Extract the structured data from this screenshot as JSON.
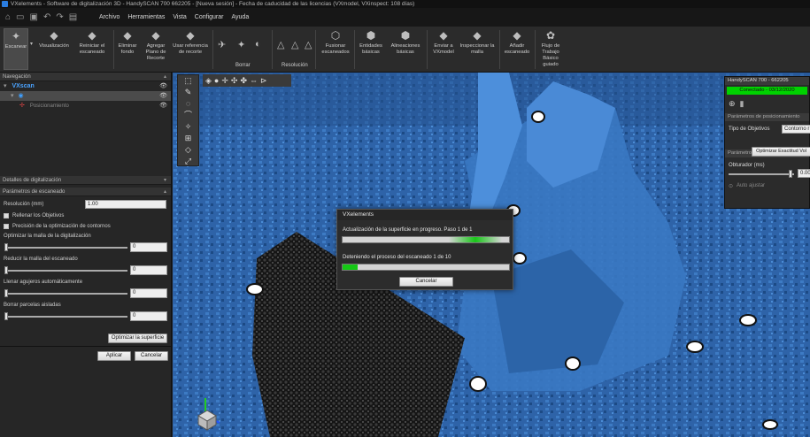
{
  "window": {
    "title": "VXelements - Software de digitalización 3D - HandySCAN 700 662205 - [Nueva sesión] - Fecha de caducidad de las licencias (VXmodel, VXinspect: 108 días)"
  },
  "menubar": {
    "items": [
      "Archivo",
      "Herramientas",
      "Vista",
      "Configurar",
      "Ayuda"
    ]
  },
  "ribbon": {
    "buttons": [
      {
        "label": "Escanear",
        "icon": "scan-icon"
      },
      {
        "label": "Visualización",
        "icon": "visualization-icon"
      },
      {
        "label": "Reiniciar el escaneado",
        "icon": "reset-scan-icon"
      },
      {
        "label": "Eliminar fondo",
        "icon": "remove-background-icon"
      },
      {
        "label": "Agregar Plano de Recorte",
        "icon": "clipping-plane-icon"
      },
      {
        "label": "Usar referencia de recorte",
        "icon": "clip-reference-icon"
      },
      {
        "label": "Fusionar escaneados",
        "icon": "merge-icon"
      },
      {
        "label": "Entidades básicas",
        "icon": "entities-icon"
      },
      {
        "label": "Alineaciones básicas",
        "icon": "alignment-icon"
      },
      {
        "label": "Enviar a VXmodel",
        "icon": "send-vxmodel-icon"
      },
      {
        "label": "Inspeccionar la malla",
        "icon": "inspect-mesh-icon"
      },
      {
        "label": "Añadir escaneado",
        "icon": "add-scan-icon"
      },
      {
        "label": "Flujo de Trabajo Básico guiado",
        "icon": "workflow-icon"
      }
    ],
    "groups": {
      "borrar": "Borrar",
      "resolucion": "Resolución"
    }
  },
  "navigation": {
    "header": "Navegación",
    "tree": [
      {
        "label": "VXscan",
        "level": 0,
        "selected": false
      },
      {
        "label": "",
        "level": 1,
        "selected": true
      },
      {
        "label": "Posicionamiento",
        "level": 2,
        "selected": false
      }
    ]
  },
  "panels": {
    "details_header": "Detalles de digitalización",
    "scan_params_header": "Parámetros de escaneado",
    "resolution_label": "Resolución (mm)",
    "resolution_value": "1.00",
    "fill_targets": "Rellenar los Objetivos",
    "contour_precision": "Precisión de la optimización de contornos",
    "optimize_mesh_label": "Optimizar la malla de la digitalización",
    "optimize_mesh_value": "0",
    "reduce_mesh_label": "Reducir la malla del escaneado",
    "reduce_mesh_value": "0",
    "fill_holes_label": "Llenar agujeros automáticamente",
    "fill_holes_value": "0",
    "remove_patches_label": "Borrar parcelas aisladas",
    "remove_patches_value": "0",
    "optimize_surface_button": "Optimizar la superficie",
    "apply_button": "Aplicar",
    "cancel_button": "Cancelar"
  },
  "right_panel": {
    "header": "HandySCAN 700 - 662205",
    "status": "Conectado - 03/12/2020",
    "positioning_header": "Parámetros de posicionamiento",
    "targets_type_label": "Tipo de Objetivos",
    "targets_type_value": "Contorno r",
    "optimize_button": "Optimizar Exactitud Vol",
    "scanner_header": "Parámetros del escáner",
    "shutter_label": "Obturador (ms)",
    "shutter_value": "0.00",
    "auto_adjust_label": "Auto ajustar"
  },
  "dialog": {
    "title": "VXelements",
    "message1": "Actualización de la superficie en progreso. Paso 1 de 1",
    "message2": "Deteniendo el proceso del escaneado 1 de 10",
    "progress2": 0.09,
    "cancel_button": "Cancelar"
  },
  "colors": {
    "accent": "#2a7de1",
    "connected": "#00d200",
    "progress": "#14c814",
    "scan_blue": "#2f6fb3"
  }
}
